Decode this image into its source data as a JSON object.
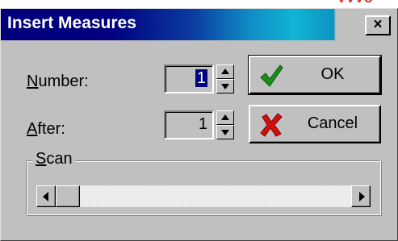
{
  "window": {
    "title": "Insert Measures",
    "close_label": "×"
  },
  "form": {
    "number_label_accel": "N",
    "number_label_rest": "umber:",
    "number_value": "1",
    "after_label_accel": "A",
    "after_label_rest": "fter:",
    "after_value": "1"
  },
  "buttons": {
    "ok_label": "OK",
    "cancel_label": "Cancel",
    "ok_icon": "green-checkmark-icon",
    "cancel_icon": "red-x-icon"
  },
  "scan": {
    "legend_accel": "S",
    "legend_rest": "can",
    "scroll_position": 0
  },
  "colors": {
    "title_bar": "#000080",
    "title_gradient_end": "#10b4d4",
    "dialog_face": "#c0c0c0",
    "ok_check": "#1a8c1a",
    "cancel_x": "#d01010",
    "selection": "#000080"
  }
}
